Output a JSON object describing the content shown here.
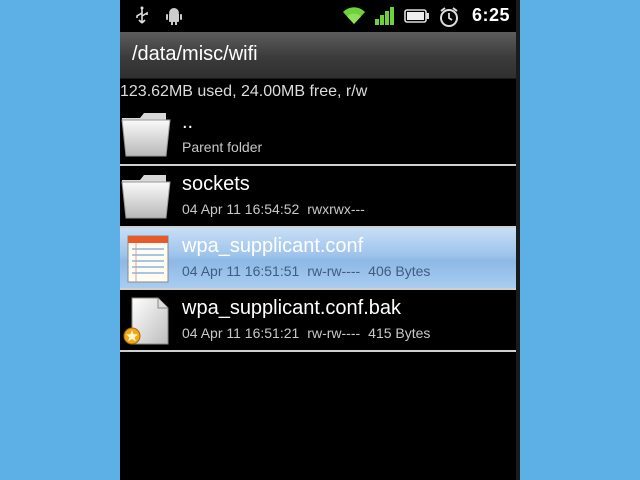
{
  "status_bar": {
    "time": "6:25",
    "icons": [
      "usb-icon",
      "android-debug-icon",
      "wifi-icon",
      "signal-icon",
      "battery-icon",
      "alarm-icon"
    ]
  },
  "path_title": "/data/misc/wifi",
  "storage_info": "123.62MB used, 24.00MB free, r/w",
  "colors": {
    "background": "#5db0e6",
    "selected_row": "#9ec4ec",
    "wifi_green": "#6fd13a"
  },
  "files": [
    {
      "name": "..",
      "icon": "folder-icon",
      "date": "",
      "permissions": "",
      "size": "",
      "subtitle": "Parent folder"
    },
    {
      "name": "sockets",
      "icon": "folder-icon",
      "date": "04 Apr 11 16:54:52",
      "permissions": "rwxrwx---",
      "size": "",
      "subtitle": ""
    },
    {
      "name": "wpa_supplicant.conf",
      "icon": "text-file-icon",
      "date": "04 Apr 11 16:51:51",
      "permissions": "rw-rw----",
      "size": "406 Bytes",
      "subtitle": "",
      "selected": true
    },
    {
      "name": "wpa_supplicant.conf.bak",
      "icon": "backup-file-icon",
      "date": "04 Apr 11 16:51:21",
      "permissions": "rw-rw----",
      "size": "415 Bytes",
      "subtitle": ""
    }
  ]
}
